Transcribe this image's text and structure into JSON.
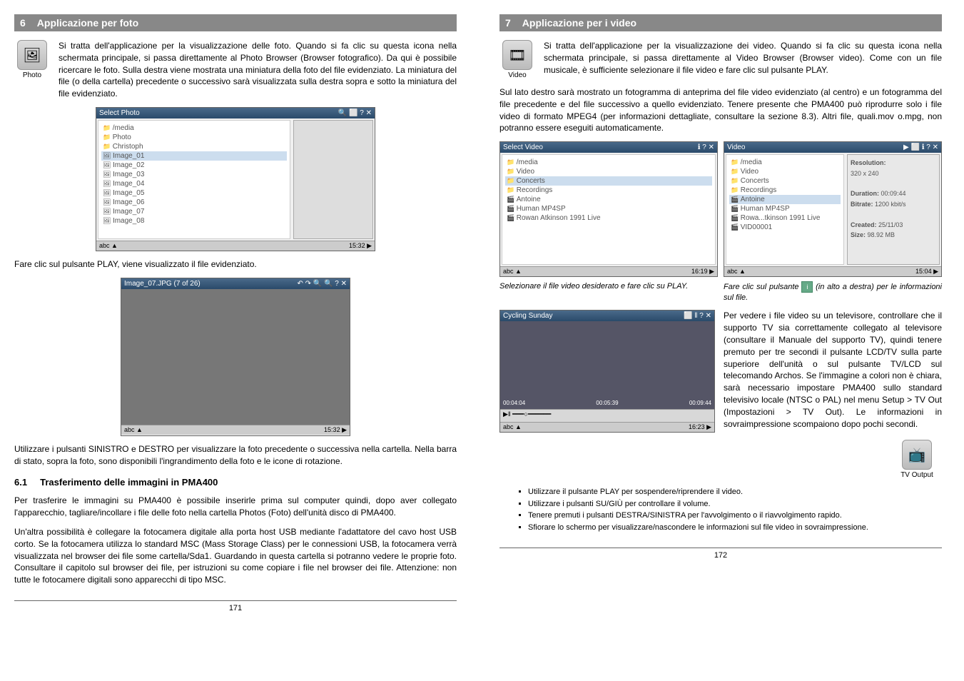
{
  "left": {
    "section_num": "6",
    "section_title": "Applicazione per foto",
    "icon_label": "Photo",
    "intro": "Si tratta dell'applicazione per la visualizzazione delle foto. Quando si fa clic su questa icona nella schermata principale, si passa direttamente al Photo Browser (Browser fotografico). Da qui è possibile ricercare le foto. Sulla destra viene mostrata una miniatura della foto del file evidenziato. La miniatura del file (o della cartella) precedente o successivo sarà visualizzata sulla destra sopra e sotto la miniatura del file evidenziato.",
    "shot1": {
      "title": "Select Photo",
      "items": [
        {
          "t": "folder",
          "n": "/media"
        },
        {
          "t": "folder",
          "n": "Photo"
        },
        {
          "t": "folder",
          "n": "Christoph"
        },
        {
          "t": "file",
          "n": "Image_01",
          "sel": true
        },
        {
          "t": "file",
          "n": "Image_02"
        },
        {
          "t": "file",
          "n": "Image_03"
        },
        {
          "t": "file",
          "n": "Image_04"
        },
        {
          "t": "file",
          "n": "Image_05"
        },
        {
          "t": "file",
          "n": "Image_06"
        },
        {
          "t": "file",
          "n": "Image_07"
        },
        {
          "t": "file",
          "n": "Image_08"
        }
      ],
      "status_time": "15:32"
    },
    "para1": "Fare clic sul pulsante PLAY, viene visualizzato il file evidenziato.",
    "shot2": {
      "title": "Image_07.JPG (7 of 26)",
      "status_time": "15:32"
    },
    "para2": "Utilizzare i pulsanti SINISTRO e DESTRO per visualizzare la foto precedente o successiva nella cartella. Nella barra di stato, sopra la foto, sono disponibili l'ingrandimento della foto e le icone di rotazione.",
    "sub_num": "6.1",
    "sub_title": "Trasferimento delle immagini in PMA400",
    "para3": "Per trasferire le immagini su PMA400 è possibile inserirle prima sul computer quindi, dopo aver collegato l'apparecchio, tagliare/incollare i file delle foto nella cartella Photos (Foto) dell'unità disco di PMA400.",
    "para4": "Un'altra possibilità è collegare la fotocamera digitale alla porta host USB mediante l'adattatore del cavo host USB corto. Se la fotocamera utilizza lo standard MSC (Mass Storage Class) per le connessioni USB, la fotocamera verrà visualizzata nel browser dei file some cartella/Sda1. Guardando in questa cartella si potranno vedere le proprie foto. Consultare il capitolo sul browser dei file, per istruzioni su come copiare i file nel browser dei file. Attenzione: non tutte le fotocamere digitali sono apparecchi di tipo MSC.",
    "page_num": "171"
  },
  "right": {
    "section_num": "7",
    "section_title": "Applicazione per i video",
    "icon_label": "Video",
    "intro": "Si tratta dell'applicazione per la visualizzazione dei video. Quando si fa clic su questa icona nella schermata principale, si passa direttamente al Video Browser (Browser video). Come con un file musicale, è sufficiente selezionare il file video e fare clic sul pulsante PLAY.",
    "para1": "Sul lato destro sarà mostrato un fotogramma di anteprima del file video evidenziato (al centro) e un fotogramma del file precedente e del file successivo a quello evidenziato. Tenere presente che PMA400 può riprodurre solo i file video di formato MPEG4 (per informazioni dettagliate, consultare la sezione 8.3). Altri file, quali.mov o.mpg, non potranno essere eseguiti automaticamente.",
    "shotL": {
      "title": "Select Video",
      "items": [
        {
          "t": "folder",
          "n": "/media"
        },
        {
          "t": "folder",
          "n": "Video"
        },
        {
          "t": "folder",
          "n": "Concerts",
          "sel": true
        },
        {
          "t": "folder",
          "n": "Recordings"
        },
        {
          "t": "vfile",
          "n": "Antoine"
        },
        {
          "t": "vfile",
          "n": "Human MP4SP"
        },
        {
          "t": "vfile",
          "n": "Rowan Atkinson 1991 Live"
        }
      ],
      "status_time": "16:19"
    },
    "shotR": {
      "title": "Video",
      "items": [
        {
          "t": "folder",
          "n": "/media"
        },
        {
          "t": "folder",
          "n": "Video"
        },
        {
          "t": "folder",
          "n": "Concerts"
        },
        {
          "t": "folder",
          "n": "Recordings"
        },
        {
          "t": "vfile",
          "n": "Antoine",
          "sel": true
        },
        {
          "t": "vfile",
          "n": "Human MP4SP"
        },
        {
          "t": "vfile",
          "n": "Rowa...tkinson 1991 Live"
        },
        {
          "t": "vfile",
          "n": "VID00001"
        }
      ],
      "info": {
        "res_label": "Resolution:",
        "res": "320 x 240",
        "dur_label": "Duration:",
        "dur": "00:09:44",
        "bit_label": "Bitrate:",
        "bit": "1200 kbit/s",
        "cre_label": "Created:",
        "cre": "25/11/03",
        "size_label": "Size:",
        "size": "98.92 MB"
      },
      "status_time": "15:04"
    },
    "captionL": "Selezionare il file video desiderato e fare clic su PLAY.",
    "captionR_pre": "Fare clic sul pulsante ",
    "captionR_post": " (in alto a destra) per le informazioni sul file.",
    "shot3": {
      "title": "Cycling Sunday",
      "t1": "00:04:04",
      "t2": "00:05:39",
      "t3": "00:09:44",
      "status_time": "16:23"
    },
    "side_text": "Per vedere i file video su un televisore, controllare che il supporto TV sia correttamente collegato al televisore (consultare il Manuale del supporto TV), quindi tenere premuto per tre secondi il pulsante LCD/TV sulla parte superiore dell'unità o sul pulsante TV/LCD sul telecomando Archos. Se l'immagine a colori non è chiara, sarà necessario impostare PMA400 sullo standard televisivo locale (NTSC o PAL) nel menu Setup > TV Out (Impostazioni > TV Out). Le informazioni in sovraimpressione scompaiono dopo pochi secondi.",
    "tv_icon_label": "TV Output",
    "bullets": [
      "Utilizzare il pulsante PLAY per sospendere/riprendere il video.",
      "Utilizzare i pulsanti SU/GIÙ per controllare il volume.",
      "Tenere premuti i pulsanti DESTRA/SINISTRA per l'avvolgimento o il riavvolgimento rapido.",
      "Sfiorare lo schermo per visualizzare/nascondere le informazioni sul file video in sovraimpressione."
    ],
    "page_num": "172"
  }
}
